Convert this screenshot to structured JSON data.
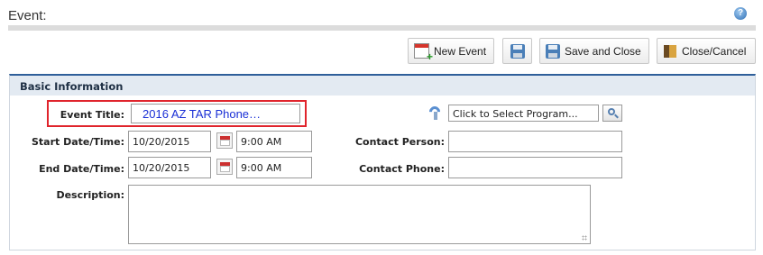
{
  "header": {
    "title": "Event:",
    "help_icon": "help-icon"
  },
  "toolbar": {
    "new_event_label": "New Event",
    "save_label": "",
    "save_close_label": "Save and Close",
    "close_cancel_label": "Close/Cancel"
  },
  "section": {
    "title": "Basic Information"
  },
  "form": {
    "event_title_label": "Event Title:",
    "event_title_value": "2016 AZ TAR Phone…",
    "program_placeholder": "Click to Select Program...",
    "start_label": "Start Date/Time:",
    "start_date": "10/20/2015",
    "start_time": "9:00 AM",
    "end_label": "End Date/Time:",
    "end_date": "10/20/2015",
    "end_time": "9:00 AM",
    "contact_person_label": "Contact Person:",
    "contact_person_value": "",
    "contact_phone_label": "Contact Phone:",
    "contact_phone_value": "",
    "description_label": "Description:",
    "description_value": ""
  },
  "colors": {
    "highlight": "#e0242c",
    "title_text": "#1a2fd6",
    "section_accent": "#2f5f9a"
  }
}
